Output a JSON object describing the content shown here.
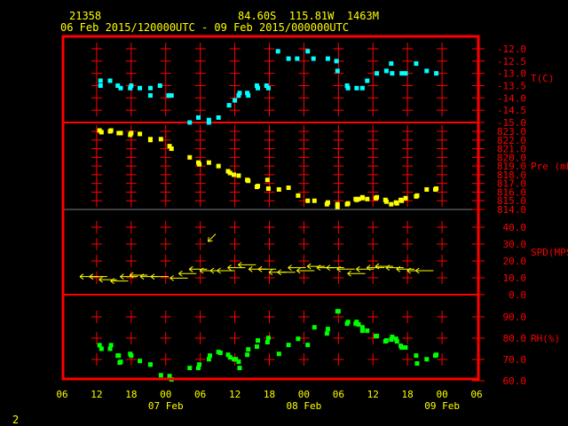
{
  "header": {
    "station": "21358",
    "location": "84.60S  115.81W  1463M",
    "period": "06 Feb 2015/120000UTC - 09 Feb 2015/000000UTC"
  },
  "page_number": "2",
  "colors": {
    "frame": "#ff0000",
    "text": "#ffff00",
    "temperature": "#00ffff",
    "pressure": "#ffff00",
    "wind": "#ffff00",
    "humidity": "#00ff00",
    "divider": "#808080"
  },
  "chart_data": {
    "type": "scatter",
    "x_axis": {
      "range": [
        "2015-02-06 06:00",
        "2015-02-09 06:00"
      ],
      "tick_labels": [
        "06",
        "12",
        "18",
        "00",
        "06",
        "12",
        "18",
        "00",
        "06",
        "12",
        "18",
        "00",
        "06"
      ],
      "date_labels": [
        {
          "time": "2015-02-07 00:00",
          "label": "07 Feb"
        },
        {
          "time": "2015-02-08 00:00",
          "label": "08 Feb"
        },
        {
          "time": "2015-02-09 00:00",
          "label": "09 Feb"
        }
      ]
    },
    "grid": "crosses",
    "panels": [
      {
        "name": "T(C)",
        "ylim": [
          -15.0,
          -12.0
        ],
        "tick_labels": [
          "-12.0",
          "-12.5",
          "-13.0",
          "-13.5",
          "-14.0",
          "-14.5",
          "-15.0"
        ],
        "color_key": "temperature",
        "points": [
          [
            "2015-02-06 12:40",
            -13.3
          ],
          [
            "2015-02-06 12:40",
            -13.5
          ],
          [
            "2015-02-06 14:20",
            -13.3
          ],
          [
            "2015-02-06 15:40",
            -13.5
          ],
          [
            "2015-02-06 16:10",
            -13.6
          ],
          [
            "2015-02-06 17:50",
            -13.6
          ],
          [
            "2015-02-06 18:00",
            -13.5
          ],
          [
            "2015-02-06 19:30",
            -13.6
          ],
          [
            "2015-02-06 21:20",
            -13.6
          ],
          [
            "2015-02-06 21:20",
            -13.9
          ],
          [
            "2015-02-06 23:00",
            -13.5
          ],
          [
            "2015-02-07 00:30",
            -13.9
          ],
          [
            "2015-02-07 01:00",
            -13.9
          ],
          [
            "2015-02-07 04:10",
            -15.0
          ],
          [
            "2015-02-07 05:40",
            -14.8
          ],
          [
            "2015-02-07 07:30",
            -14.9
          ],
          [
            "2015-02-07 07:30",
            -15.0
          ],
          [
            "2015-02-07 09:10",
            -14.8
          ],
          [
            "2015-02-07 11:00",
            -14.3
          ],
          [
            "2015-02-07 12:00",
            -14.1
          ],
          [
            "2015-02-07 12:40",
            -13.9
          ],
          [
            "2015-02-07 12:50",
            -13.8
          ],
          [
            "2015-02-07 14:10",
            -13.8
          ],
          [
            "2015-02-07 14:20",
            -13.9
          ],
          [
            "2015-02-07 15:50",
            -13.5
          ],
          [
            "2015-02-07 16:00",
            -13.6
          ],
          [
            "2015-02-07 17:30",
            -13.5
          ],
          [
            "2015-02-07 17:50",
            -13.6
          ],
          [
            "2015-02-07 19:30",
            -12.1
          ],
          [
            "2015-02-07 21:20",
            -12.4
          ],
          [
            "2015-02-07 22:50",
            -12.4
          ],
          [
            "2015-02-08 00:40",
            -12.1
          ],
          [
            "2015-02-08 01:40",
            -12.4
          ],
          [
            "2015-02-08 04:10",
            -12.4
          ],
          [
            "2015-02-08 05:40",
            -12.5
          ],
          [
            "2015-02-08 05:50",
            -12.9
          ],
          [
            "2015-02-08 07:30",
            -13.5
          ],
          [
            "2015-02-08 07:40",
            -13.6
          ],
          [
            "2015-02-08 09:10",
            -13.6
          ],
          [
            "2015-02-08 10:10",
            -13.6
          ],
          [
            "2015-02-08 11:00",
            -13.3
          ],
          [
            "2015-02-08 12:40",
            -13.0
          ],
          [
            "2015-02-08 14:20",
            -12.9
          ],
          [
            "2015-02-08 15:10",
            -12.6
          ],
          [
            "2015-02-08 15:20",
            -13.0
          ],
          [
            "2015-02-08 17:00",
            -13.0
          ],
          [
            "2015-02-08 17:40",
            -13.0
          ],
          [
            "2015-02-08 19:30",
            -12.6
          ],
          [
            "2015-02-08 21:20",
            -12.9
          ],
          [
            "2015-02-08 23:00",
            -13.0
          ]
        ]
      },
      {
        "name": "Pre (mb)",
        "ylim": [
          814.0,
          823.0
        ],
        "tick_labels": [
          "823.0",
          "822.0",
          "821.0",
          "820.0",
          "819.0",
          "818.0",
          "817.0",
          "816.0",
          "815.0",
          "814.0"
        ],
        "color_key": "pressure",
        "points": [
          [
            "2015-02-06 12:30",
            823.1
          ],
          [
            "2015-02-06 12:50",
            822.9
          ],
          [
            "2015-02-06 14:20",
            823.0
          ],
          [
            "2015-02-06 14:30",
            823.1
          ],
          [
            "2015-02-06 15:50",
            822.8
          ],
          [
            "2015-02-06 16:10",
            822.8
          ],
          [
            "2015-02-06 17:50",
            822.6
          ],
          [
            "2015-02-06 18:00",
            822.8
          ],
          [
            "2015-02-06 19:30",
            822.7
          ],
          [
            "2015-02-06 21:20",
            822.0
          ],
          [
            "2015-02-06 21:20",
            822.1
          ],
          [
            "2015-02-06 23:10",
            822.1
          ],
          [
            "2015-02-07 00:40",
            821.3
          ],
          [
            "2015-02-07 01:00",
            821.0
          ],
          [
            "2015-02-07 04:10",
            820.0
          ],
          [
            "2015-02-07 05:40",
            819.4
          ],
          [
            "2015-02-07 05:50",
            819.2
          ],
          [
            "2015-02-07 07:30",
            819.4
          ],
          [
            "2015-02-07 09:10",
            819.0
          ],
          [
            "2015-02-07 10:50",
            818.4
          ],
          [
            "2015-02-07 11:10",
            818.2
          ],
          [
            "2015-02-07 11:50",
            818.0
          ],
          [
            "2015-02-07 12:40",
            817.9
          ],
          [
            "2015-02-07 14:10",
            817.4
          ],
          [
            "2015-02-07 14:20",
            817.3
          ],
          [
            "2015-02-07 15:50",
            816.6
          ],
          [
            "2015-02-07 16:00",
            816.7
          ],
          [
            "2015-02-07 17:40",
            817.4
          ],
          [
            "2015-02-07 17:50",
            816.4
          ],
          [
            "2015-02-07 19:40",
            816.3
          ],
          [
            "2015-02-07 21:20",
            816.5
          ],
          [
            "2015-02-07 23:00",
            815.6
          ],
          [
            "2015-02-08 00:40",
            815.0
          ],
          [
            "2015-02-08 01:50",
            815.0
          ],
          [
            "2015-02-08 04:00",
            814.6
          ],
          [
            "2015-02-08 04:10",
            814.8
          ],
          [
            "2015-02-08 05:50",
            814.3
          ],
          [
            "2015-02-08 05:50",
            814.6
          ],
          [
            "2015-02-08 07:30",
            814.6
          ],
          [
            "2015-02-08 07:40",
            814.7
          ],
          [
            "2015-02-08 09:00",
            815.2
          ],
          [
            "2015-02-08 09:10",
            815.1
          ],
          [
            "2015-02-08 09:30",
            815.2
          ],
          [
            "2015-02-08 10:10",
            815.4
          ],
          [
            "2015-02-08 10:10",
            815.3
          ],
          [
            "2015-02-08 11:00",
            815.2
          ],
          [
            "2015-02-08 12:30",
            815.3
          ],
          [
            "2015-02-08 12:40",
            815.4
          ],
          [
            "2015-02-08 14:10",
            815.1
          ],
          [
            "2015-02-08 14:20",
            814.9
          ],
          [
            "2015-02-08 15:10",
            814.6
          ],
          [
            "2015-02-08 16:00",
            814.8
          ],
          [
            "2015-02-08 16:10",
            814.7
          ],
          [
            "2015-02-08 16:50",
            815.1
          ],
          [
            "2015-02-08 17:00",
            815.0
          ],
          [
            "2015-02-08 17:40",
            815.3
          ],
          [
            "2015-02-08 19:30",
            815.5
          ],
          [
            "2015-02-08 19:40",
            815.6
          ],
          [
            "2015-02-08 21:20",
            816.3
          ],
          [
            "2015-02-08 22:50",
            816.3
          ],
          [
            "2015-02-08 23:00",
            816.4
          ]
        ]
      },
      {
        "name": "SPD(MPS)",
        "ylim": [
          0.0,
          40.0
        ],
        "tick_labels": [
          "40.0",
          "30.0",
          "20.0",
          "10.0",
          "0.0"
        ],
        "color_key": "wind",
        "marker": "wind-arrow",
        "points": [
          [
            "2015-02-06 12:10",
            10.7,
            90
          ],
          [
            "2015-02-06 13:50",
            10.7,
            90
          ],
          [
            "2015-02-06 15:30",
            8.9,
            90
          ],
          [
            "2015-02-06 17:30",
            8.1,
            90
          ],
          [
            "2015-02-06 19:10",
            10.7,
            90
          ],
          [
            "2015-02-06 20:50",
            11.6,
            90
          ],
          [
            "2015-02-06 22:40",
            10.7,
            90
          ],
          [
            "2015-02-07 00:30",
            10.7,
            90
          ],
          [
            "2015-02-07 03:50",
            9.8,
            90
          ],
          [
            "2015-02-07 05:20",
            12.5,
            90
          ],
          [
            "2015-02-07 07:10",
            15.1,
            90
          ],
          [
            "2015-02-07 08:40",
            36.0,
            45
          ],
          [
            "2015-02-07 09:00",
            14.2,
            90
          ],
          [
            "2015-02-07 10:50",
            14.2,
            90
          ],
          [
            "2015-02-07 12:00",
            14.2,
            90
          ],
          [
            "2015-02-07 13:50",
            16.0,
            90
          ],
          [
            "2015-02-07 15:40",
            17.7,
            90
          ],
          [
            "2015-02-07 17:30",
            15.1,
            90
          ],
          [
            "2015-02-07 19:10",
            15.1,
            90
          ],
          [
            "2015-02-07 21:00",
            13.3,
            90
          ],
          [
            "2015-02-07 22:30",
            13.3,
            90
          ],
          [
            "2015-02-08 00:20",
            16.0,
            90
          ],
          [
            "2015-02-08 01:50",
            14.2,
            90
          ],
          [
            "2015-02-08 03:40",
            16.8,
            90
          ],
          [
            "2015-02-08 05:20",
            16.0,
            90
          ],
          [
            "2015-02-08 07:00",
            16.0,
            90
          ],
          [
            "2015-02-08 08:50",
            15.1,
            90
          ],
          [
            "2015-02-08 10:40",
            12.5,
            90
          ],
          [
            "2015-02-08 12:10",
            15.1,
            90
          ],
          [
            "2015-02-08 14:00",
            16.0,
            90
          ],
          [
            "2015-02-08 15:30",
            16.8,
            90
          ],
          [
            "2015-02-08 17:20",
            16.0,
            90
          ],
          [
            "2015-02-08 19:10",
            15.1,
            90
          ],
          [
            "2015-02-08 21:00",
            14.2,
            90
          ],
          [
            "2015-02-08 22:30",
            14.2,
            90
          ]
        ]
      },
      {
        "name": "RH(%)",
        "ylim": [
          60.0,
          90.0
        ],
        "tick_labels": [
          "90.0",
          "80.0",
          "70.0",
          "60.0"
        ],
        "color_key": "humidity",
        "points": [
          [
            "2015-02-06 12:30",
            76.7
          ],
          [
            "2015-02-06 12:50",
            75.0
          ],
          [
            "2015-02-06 14:20",
            75.0
          ],
          [
            "2015-02-06 14:30",
            76.7
          ],
          [
            "2015-02-06 15:40",
            71.8
          ],
          [
            "2015-02-06 15:50",
            71.8
          ],
          [
            "2015-02-06 16:00",
            68.5
          ],
          [
            "2015-02-06 16:10",
            68.9
          ],
          [
            "2015-02-06 17:50",
            72.6
          ],
          [
            "2015-02-06 18:00",
            71.8
          ],
          [
            "2015-02-06 19:30",
            69.3
          ],
          [
            "2015-02-06 21:20",
            67.6
          ],
          [
            "2015-02-06 21:20",
            67.6
          ],
          [
            "2015-02-06 23:10",
            62.6
          ],
          [
            "2015-02-07 00:40",
            62.2
          ],
          [
            "2015-02-07 01:00",
            60.6
          ],
          [
            "2015-02-07 04:10",
            66.0
          ],
          [
            "2015-02-07 05:40",
            66.0
          ],
          [
            "2015-02-07 05:50",
            67.6
          ],
          [
            "2015-02-07 07:30",
            70.1
          ],
          [
            "2015-02-07 07:40",
            71.8
          ],
          [
            "2015-02-07 09:10",
            73.5
          ],
          [
            "2015-02-07 09:30",
            73.1
          ],
          [
            "2015-02-07 10:50",
            72.2
          ],
          [
            "2015-02-07 11:10",
            71.0
          ],
          [
            "2015-02-07 11:50",
            70.1
          ],
          [
            "2015-02-07 12:10",
            70.1
          ],
          [
            "2015-02-07 12:40",
            68.9
          ],
          [
            "2015-02-07 12:50",
            66.0
          ],
          [
            "2015-02-07 14:10",
            72.2
          ],
          [
            "2015-02-07 14:20",
            74.7
          ],
          [
            "2015-02-07 15:50",
            76.0
          ],
          [
            "2015-02-07 16:00",
            78.9
          ],
          [
            "2015-02-07 17:40",
            78.1
          ],
          [
            "2015-02-07 17:50",
            80.1
          ],
          [
            "2015-02-07 19:40",
            72.6
          ],
          [
            "2015-02-07 21:20",
            76.8
          ],
          [
            "2015-02-07 23:00",
            79.7
          ],
          [
            "2015-02-08 00:40",
            76.8
          ],
          [
            "2015-02-08 01:50",
            85.1
          ],
          [
            "2015-02-08 04:00",
            82.2
          ],
          [
            "2015-02-08 04:10",
            84.3
          ],
          [
            "2015-02-08 05:50",
            92.6
          ],
          [
            "2015-02-08 06:00",
            92.6
          ],
          [
            "2015-02-08 07:30",
            86.8
          ],
          [
            "2015-02-08 07:40",
            87.6
          ],
          [
            "2015-02-08 09:00",
            86.8
          ],
          [
            "2015-02-08 09:10",
            87.6
          ],
          [
            "2015-02-08 09:30",
            86.4
          ],
          [
            "2015-02-08 10:10",
            83.5
          ],
          [
            "2015-02-08 10:10",
            85.1
          ],
          [
            "2015-02-08 11:00",
            83.5
          ],
          [
            "2015-02-08 12:30",
            81.0
          ],
          [
            "2015-02-08 12:40",
            81.0
          ],
          [
            "2015-02-08 14:10",
            78.5
          ],
          [
            "2015-02-08 14:20",
            78.9
          ],
          [
            "2015-02-08 15:10",
            79.3
          ],
          [
            "2015-02-08 15:20",
            80.6
          ],
          [
            "2015-02-08 16:00",
            79.7
          ],
          [
            "2015-02-08 16:10",
            78.5
          ],
          [
            "2015-02-08 16:50",
            76.4
          ],
          [
            "2015-02-08 17:00",
            75.6
          ],
          [
            "2015-02-08 17:40",
            75.6
          ],
          [
            "2015-02-08 19:30",
            71.8
          ],
          [
            "2015-02-08 19:40",
            68.1
          ],
          [
            "2015-02-08 21:20",
            70.1
          ],
          [
            "2015-02-08 22:50",
            71.8
          ],
          [
            "2015-02-08 23:00",
            72.2
          ]
        ]
      }
    ]
  }
}
